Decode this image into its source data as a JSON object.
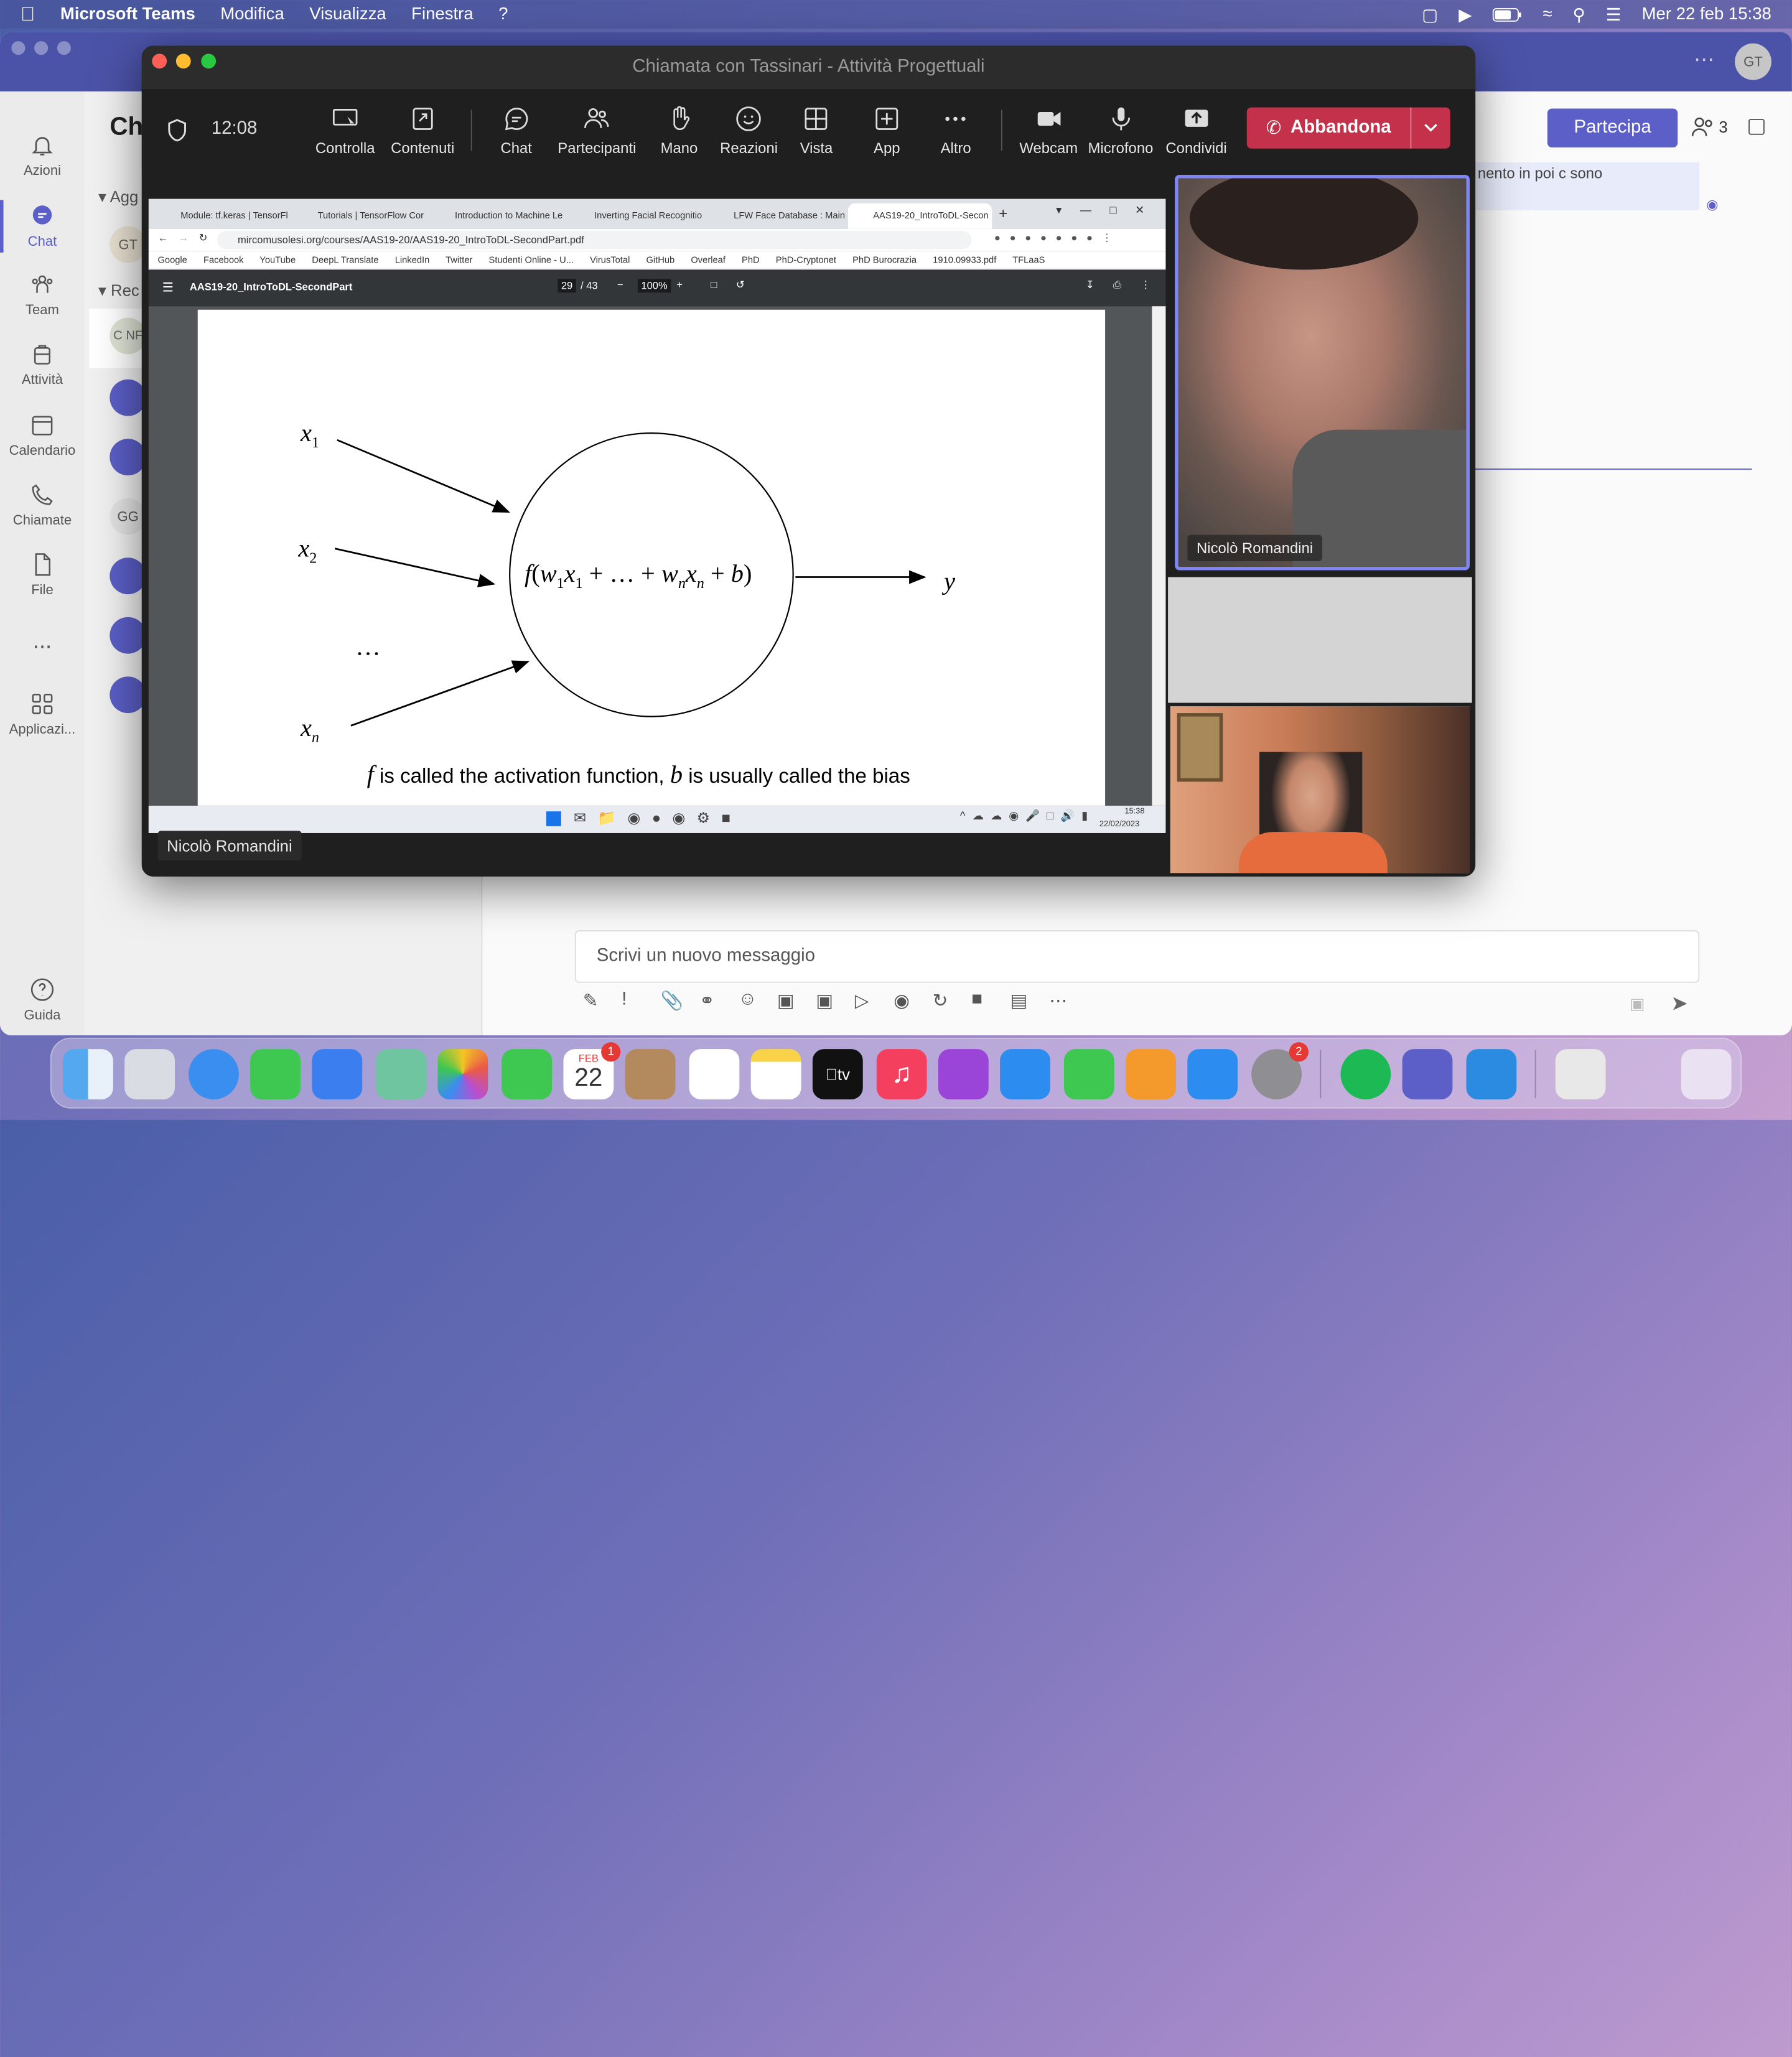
{
  "menubar": {
    "app_name": "Microsoft Teams",
    "menus": [
      "Modifica",
      "Visualizza",
      "Finestra",
      "?"
    ],
    "datetime": "Mer 22 feb  15:38"
  },
  "teams": {
    "header_title_partial": "Ch",
    "user_initials": "GT",
    "rail": [
      {
        "label": "Azioni",
        "icon": "bell-icon"
      },
      {
        "label": "Chat",
        "icon": "chat-icon"
      },
      {
        "label": "Team",
        "icon": "team-icon"
      },
      {
        "label": "Attività",
        "icon": "briefcase-icon"
      },
      {
        "label": "Calendario",
        "icon": "calendar-icon"
      },
      {
        "label": "Chiamate",
        "icon": "phone-icon"
      },
      {
        "label": "File",
        "icon": "file-icon"
      },
      {
        "label": "...",
        "icon": "more-icon"
      },
      {
        "label": "Applicazi...",
        "icon": "apps-icon"
      },
      {
        "label": "Guida",
        "icon": "help-icon"
      }
    ],
    "chatlist": {
      "section1": "Agg",
      "section2": "Rec",
      "avatars": [
        "GT",
        "C NF",
        "GG"
      ]
    },
    "partecipa_label": "Partecipa",
    "participants_count": "3",
    "composer_placeholder": "Scrivi un nuovo messaggio",
    "partial_message": "nento in poi c sono"
  },
  "call": {
    "window_title": "Chiamata con Tassinari - Attività Progettuali",
    "timer": "12:08",
    "toolbar": [
      {
        "label": "Controlla",
        "icon": "screen-control-icon"
      },
      {
        "label": "Contenuti",
        "icon": "share-content-icon"
      },
      {
        "label": "Chat",
        "icon": "chat-bubble-icon"
      },
      {
        "label": "Partecipanti",
        "icon": "participants-icon"
      },
      {
        "label": "Mano",
        "icon": "raise-hand-icon"
      },
      {
        "label": "Reazioni",
        "icon": "smiley-icon"
      },
      {
        "label": "Vista",
        "icon": "grid-view-icon"
      },
      {
        "label": "App",
        "icon": "add-app-icon"
      },
      {
        "label": "Altro",
        "icon": "more-horizontal-icon"
      },
      {
        "label": "Webcam",
        "icon": "video-camera-icon"
      },
      {
        "label": "Microfono",
        "icon": "microphone-icon"
      },
      {
        "label": "Condividi",
        "icon": "share-upload-icon"
      }
    ],
    "leave_label": "Abbandona",
    "presenter_name": "Nicolò Romandini",
    "video_tile_name": "Nicolò Romandini"
  },
  "browser": {
    "tabs": [
      "Module: tf.keras | TensorFl",
      "Tutorials | TensorFlow Cor",
      "Introduction to Machine Le",
      "Inverting Facial Recognitio",
      "LFW Face Database : Main",
      "AAS19-20_IntroToDL-Secon"
    ],
    "url": "mircomusolesi.org/courses/AAS19-20/AAS19-20_IntroToDL-SecondPart.pdf",
    "bookmarks": [
      "Google",
      "Facebook",
      "YouTube",
      "DeepL Translate",
      "LinkedIn",
      "Twitter",
      "Studenti Online - U...",
      "VirusTotal",
      "GitHub",
      "Overleaf",
      "PhD",
      "PhD-Cryptonet",
      "PhD Burocrazia",
      "1910.09933.pdf",
      "TFLaaS"
    ],
    "pdf_title": "AAS19-20_IntroToDL-SecondPart",
    "page_current": "29",
    "page_total": "/ 43",
    "zoom": "100%",
    "taskbar_time": "15:38",
    "taskbar_date": "22/02/2023"
  },
  "slide": {
    "input1": "x",
    "input1_sub": "1",
    "input2": "x",
    "input2_sub": "2",
    "ellipsis": "…",
    "inputn": "x",
    "inputn_sub": "n",
    "output": "y",
    "caption_f": "f",
    "caption_mid": " is called the activation function, ",
    "caption_b": "b",
    "caption_end": " is usually called the bias"
  },
  "dock": {
    "calendar_month": "FEB",
    "calendar_day": "22",
    "calendar_badge": "1",
    "settings_badge": "2",
    "apps": [
      "finder-icon",
      "launchpad-icon",
      "safari-icon",
      "messages-icon",
      "mail-icon",
      "maps-icon",
      "photos-icon",
      "facetime-icon",
      "calendar-icon",
      "contacts-icon",
      "reminders-icon",
      "notes-icon",
      "appletv-icon",
      "music-icon",
      "podcasts-icon",
      "keynote-icon",
      "numbers-icon",
      "pages-icon",
      "appstore-icon",
      "settings-icon",
      "spotify-icon",
      "teams-icon",
      "vscode-icon",
      "preview-icon",
      "trash-icon"
    ]
  }
}
